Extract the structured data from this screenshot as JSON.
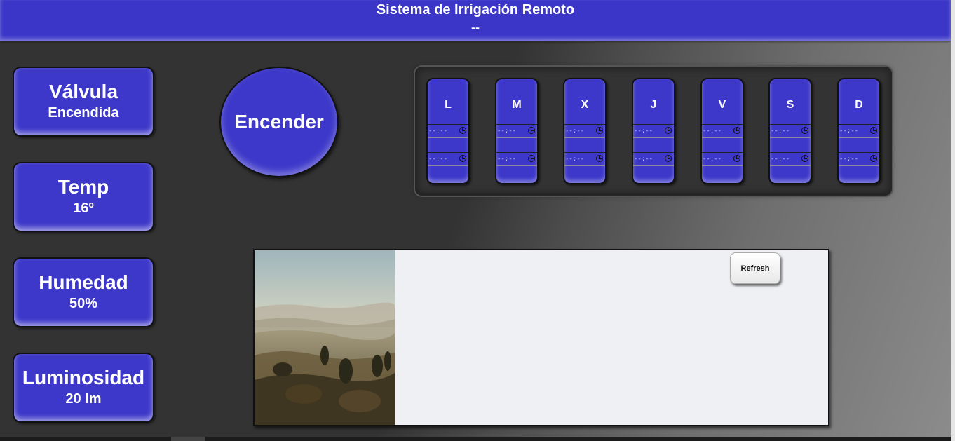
{
  "header": {
    "title": "Sistema de Irrigación Remoto",
    "subtitle": "--"
  },
  "stats": [
    {
      "label": "Válvula",
      "value": "Encendida"
    },
    {
      "label": "Temp",
      "value": "16º"
    },
    {
      "label": "Humedad",
      "value": "50%"
    },
    {
      "label": "Luminosidad",
      "value": "20 lm"
    }
  ],
  "valve_button": {
    "label": "Encender"
  },
  "schedule": {
    "days": [
      "L",
      "M",
      "X",
      "J",
      "V",
      "S",
      "D"
    ],
    "time_placeholder": "--:--"
  },
  "camera": {
    "refresh_label": "Refresh",
    "image": "landscape-photo"
  },
  "colors": {
    "accent": "#3d38c9",
    "header": "#3b36c8",
    "panel": "#eff0f3"
  }
}
